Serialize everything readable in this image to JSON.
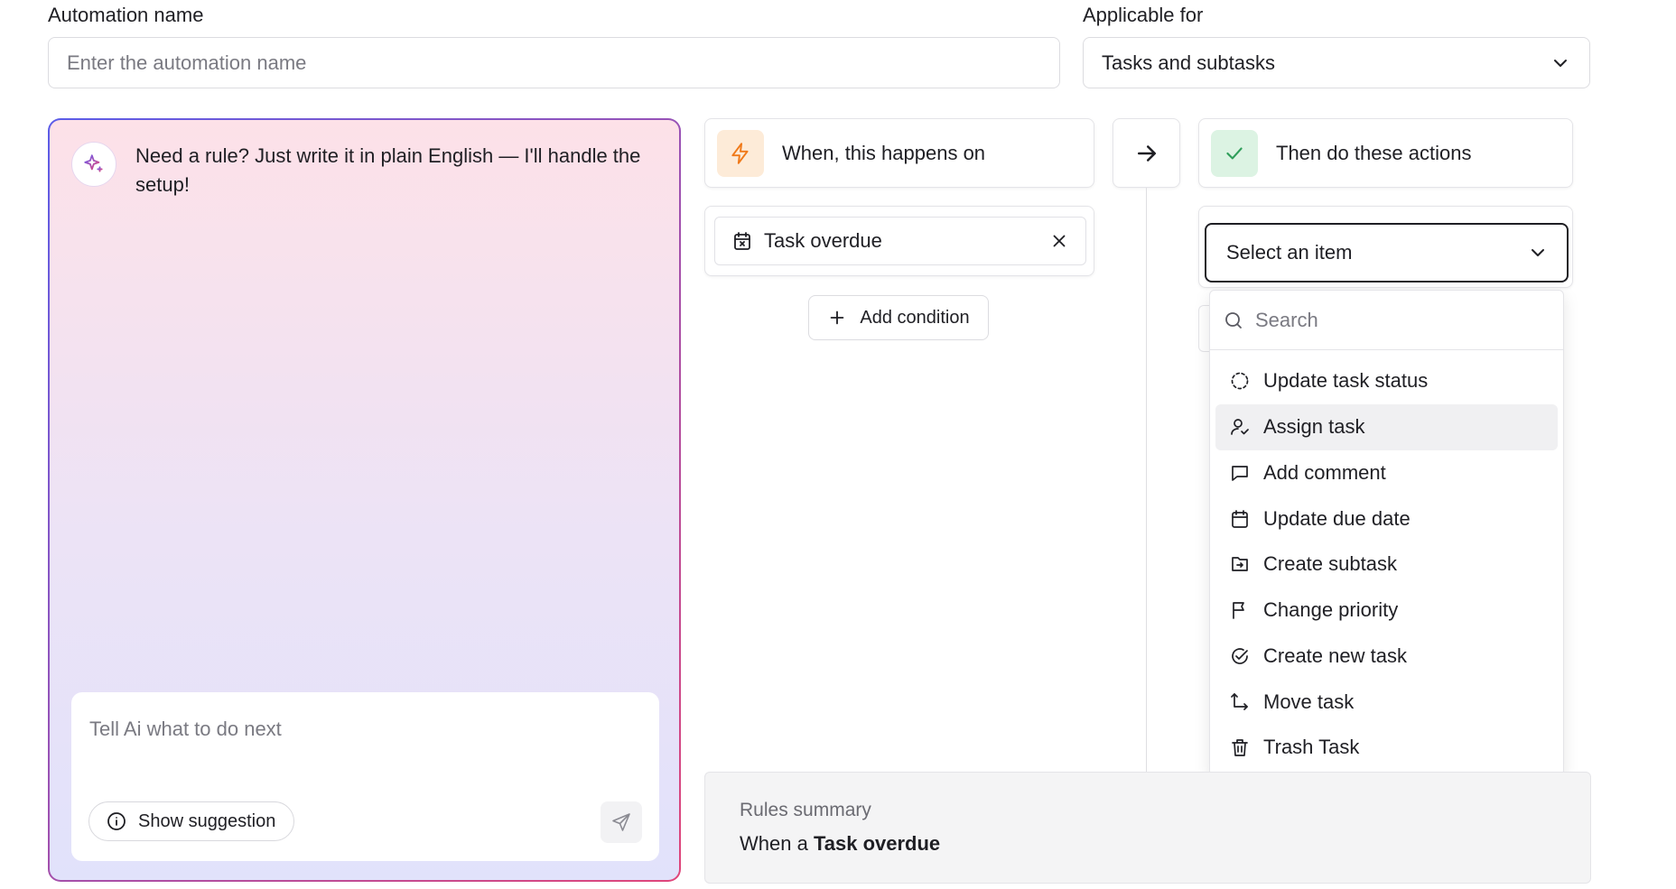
{
  "form": {
    "name_label": "Automation name",
    "name_placeholder": "Enter the automation name",
    "applicable_label": "Applicable for",
    "applicable_value": "Tasks and subtasks"
  },
  "ai": {
    "message": "Need a rule? Just write it in plain English — I'll handle the setup!",
    "input_placeholder": "Tell Ai what to do next",
    "suggestion_label": "Show suggestion",
    "gradient_start": "#5b5ce8",
    "gradient_end": "#e0467a"
  },
  "trigger": {
    "title": "When, this happens on",
    "chip_label": "Task overdue",
    "add_condition_label": "Add condition",
    "accent": "#f07a1a"
  },
  "actions": {
    "title": "Then do these actions",
    "select_placeholder": "Select an item",
    "search_placeholder": "Search",
    "accent": "#2f9e5a",
    "items": [
      {
        "label": "Update task status",
        "icon": "dashed-circle-icon"
      },
      {
        "label": "Assign task",
        "icon": "user-check-icon",
        "active": true
      },
      {
        "label": "Add comment",
        "icon": "comment-icon"
      },
      {
        "label": "Update due date",
        "icon": "calendar-icon"
      },
      {
        "label": "Create subtask",
        "icon": "subtask-icon"
      },
      {
        "label": "Change priority",
        "icon": "flag-icon"
      },
      {
        "label": "Create new task",
        "icon": "check-circle-icon"
      },
      {
        "label": "Move task",
        "icon": "move-icon"
      },
      {
        "label": "Trash Task",
        "icon": "trash-icon"
      }
    ]
  },
  "summary": {
    "title": "Rules summary",
    "prefix": "When a",
    "trigger": "Task overdue"
  }
}
